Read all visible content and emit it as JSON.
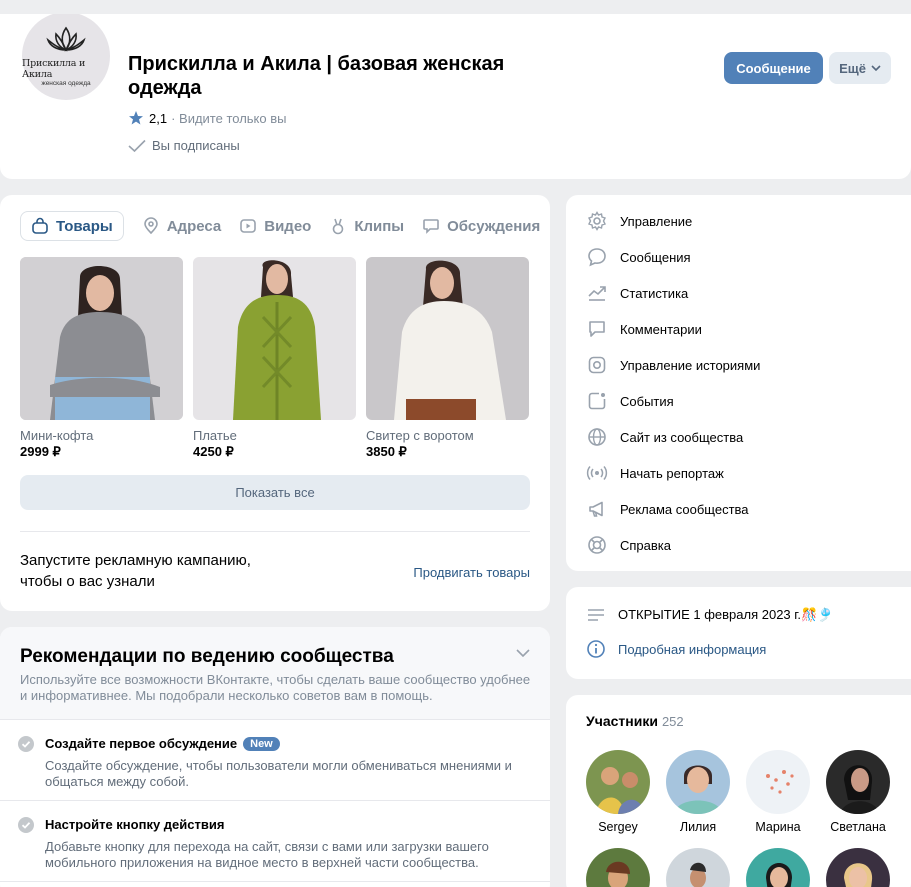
{
  "header": {
    "logo_text": "Прискилла и Акила",
    "logo_sub": "женская одежда",
    "title": "Прискилла и Акила | базовая женская одежда",
    "rating": "2,1",
    "visibility": "· Видите только вы",
    "subscribed": "Вы подписаны",
    "message_button": "Сообщение",
    "more_button": "Ещё"
  },
  "goods": {
    "tabs": [
      "Товары",
      "Адреса",
      "Видео",
      "Клипы",
      "Обсуждения"
    ],
    "products": [
      {
        "name": "Мини-кофта",
        "price": "2999 ₽",
        "color": "#8f8f93"
      },
      {
        "name": "Платье",
        "price": "4250 ₽",
        "color": "#7f9a2c"
      },
      {
        "name": "Свитер с воротом",
        "price": "3850 ₽",
        "color": "#f1efe9"
      }
    ],
    "show_all": "Показать все",
    "promo_text": "Запустите рекламную кампанию, чтобы о вас узнали",
    "promo_link": "Продвигать товары"
  },
  "recommendations": {
    "title": "Рекомендации по ведению сообщества",
    "description": "Используйте все возможности ВКонтакте, чтобы сделать ваше сообщество удобнее и информативнее. Мы подобрали несколько советов вам в помощь.",
    "items": [
      {
        "title": "Создайте первое обсуждение",
        "badge": "New",
        "desc": "Создайте обсуждение, чтобы пользователи могли обмениваться мнениями и общаться между собой."
      },
      {
        "title": "Настройте кнопку действия",
        "badge": "",
        "desc": "Добавьте кнопку для перехода на сайт, связи с вами или загрузки вашего мобильного приложения на видное место в верхней части сообщества."
      }
    ]
  },
  "management": {
    "items": [
      {
        "label": "Управление",
        "icon": "gear-icon"
      },
      {
        "label": "Сообщения",
        "icon": "message-icon"
      },
      {
        "label": "Статистика",
        "icon": "stats-icon"
      },
      {
        "label": "Комментарии",
        "icon": "comment-icon"
      },
      {
        "label": "Управление историями",
        "icon": "stories-icon"
      },
      {
        "label": "События",
        "icon": "events-icon"
      },
      {
        "label": "Сайт из сообщества",
        "icon": "globe-icon"
      },
      {
        "label": "Начать репортаж",
        "icon": "broadcast-icon"
      },
      {
        "label": "Реклама сообщества",
        "icon": "megaphone-icon"
      },
      {
        "label": "Справка",
        "icon": "help-icon"
      }
    ]
  },
  "info": {
    "status": "ОТКРЫТИЕ 1 февраля 2023 г.🎊🎐",
    "details_link": "Подробная информация"
  },
  "members": {
    "title": "Участники",
    "count": "252",
    "people": [
      {
        "name": "Sergey",
        "color": "#6f8a4a"
      },
      {
        "name": "Лилия",
        "color": "#7fa8c9"
      },
      {
        "name": "Марина",
        "color": "#e9eef3"
      },
      {
        "name": "Светлана",
        "color": "#2b2b2b"
      }
    ]
  }
}
